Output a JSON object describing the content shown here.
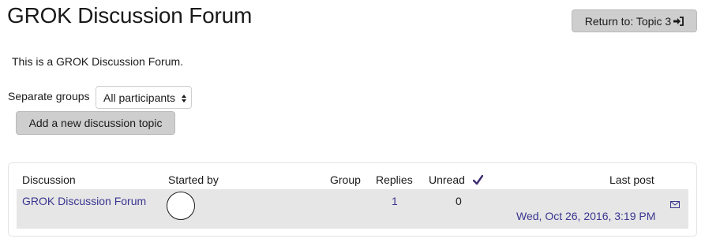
{
  "page": {
    "title": "GROK Discussion Forum",
    "return_label": "Return to: Topic 3",
    "intro": "This is a GROK Discussion Forum."
  },
  "groups": {
    "label": "Separate groups",
    "selected": "All participants"
  },
  "add_topic_label": "Add a new discussion topic",
  "table": {
    "columns": {
      "discussion": "Discussion",
      "started_by": "Started by",
      "group": "Group",
      "replies": "Replies",
      "unread": "Unread",
      "last_post": "Last post"
    },
    "rows": [
      {
        "discussion": "GROK Discussion Forum",
        "group": "",
        "replies": "1",
        "unread": "0",
        "last_post": "Wed, Oct 26, 2016, 3:19 PM"
      }
    ]
  },
  "icons": {
    "return": "sign-in-icon",
    "select_arrows": "sort-arrows-icon",
    "unread_check": "checkmark-icon",
    "subscribe": "envelope-icon",
    "avatar": "user-avatar"
  },
  "colors": {
    "link": "#3a3590",
    "button_bg": "#cecece",
    "row_bg": "#e6e6e6",
    "check": "#3d2b73"
  }
}
